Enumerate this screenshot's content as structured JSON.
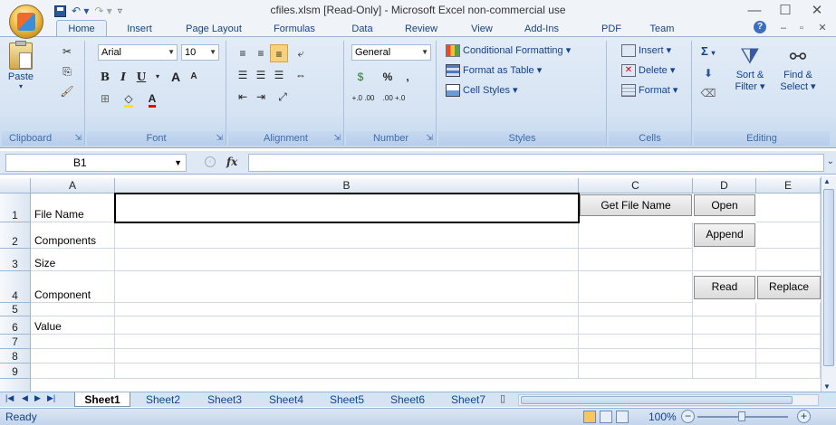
{
  "window": {
    "title": "cfiles.xlsm  [Read-Only] - Microsoft Excel non-commercial use",
    "minimize": "—",
    "maximize": "☐",
    "close": "✕"
  },
  "quick_access": [
    "save-icon",
    "undo-icon",
    "redo-icon",
    "customize-icon"
  ],
  "ribbon_tabs": [
    "Home",
    "Insert",
    "Page Layout",
    "Formulas",
    "Data",
    "Review",
    "View",
    "Add-Ins",
    "PDF",
    "Team"
  ],
  "ribbon": {
    "clipboard": {
      "label": "Clipboard",
      "paste": "Paste"
    },
    "font": {
      "label": "Font",
      "name": "Arial",
      "size": "10",
      "bold": "B",
      "italic": "I",
      "underline": "U",
      "grow": "A",
      "shrink": "A"
    },
    "alignment": {
      "label": "Alignment"
    },
    "number": {
      "label": "Number",
      "format": "General",
      "percent": "%",
      "comma": ",",
      "inc_decimal": "+.0 .00",
      "dec_decimal": ".00 +.0"
    },
    "styles": {
      "label": "Styles",
      "conditional": "Conditional Formatting",
      "format_table": "Format as Table",
      "cell_styles": "Cell Styles"
    },
    "cells": {
      "label": "Cells",
      "insert": "Insert",
      "delete": "Delete",
      "format": "Format"
    },
    "editing": {
      "label": "Editing",
      "sum": "Σ",
      "sort_filter_1": "Sort &",
      "sort_filter_2": "Filter",
      "find_select_1": "Find &",
      "find_select_2": "Select"
    }
  },
  "formula_bar": {
    "name_box": "B1",
    "fx": "fx",
    "formula": ""
  },
  "columns": [
    "A",
    "B",
    "C",
    "D",
    "E"
  ],
  "rows": [
    "1",
    "2",
    "3",
    "4",
    "5",
    "6",
    "7",
    "8",
    "9"
  ],
  "cells": {
    "A1": "File Name",
    "A2": "Components",
    "A3": "Size",
    "A4": "Component",
    "A6": "Value"
  },
  "buttons": {
    "get_file_name": "Get File Name",
    "open": "Open",
    "append": "Append",
    "read": "Read",
    "replace": "Replace"
  },
  "sheets": [
    "Sheet1",
    "Sheet2",
    "Sheet3",
    "Sheet4",
    "Sheet5",
    "Sheet6",
    "Sheet7"
  ],
  "active_sheet": "Sheet1",
  "status": {
    "text": "Ready",
    "zoom": "100%",
    "zoom_minus": "−",
    "zoom_plus": "+"
  }
}
